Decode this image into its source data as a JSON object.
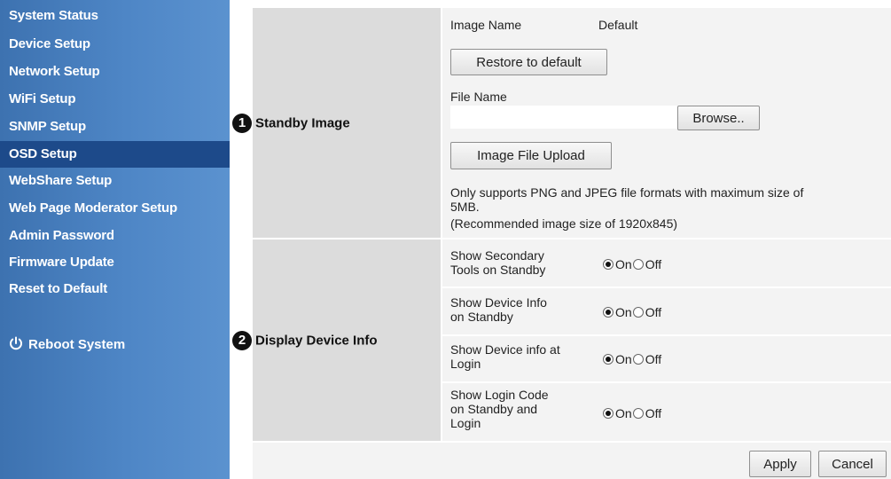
{
  "sidebar": {
    "items": [
      {
        "label": "System Status"
      },
      {
        "label": "Device Setup"
      },
      {
        "label": "Network Setup"
      },
      {
        "label": "WiFi Setup"
      },
      {
        "label": "SNMP Setup"
      },
      {
        "label": "OSD Setup",
        "active": true
      },
      {
        "label": "WebShare Setup"
      },
      {
        "label": "Web Page Moderator Setup"
      },
      {
        "label": "Admin Password"
      },
      {
        "label": "Firmware Update"
      },
      {
        "label": "Reset to Default"
      }
    ],
    "reboot_label": "Reboot System",
    "reboot_icon": "power-icon"
  },
  "standby": {
    "badge": "1",
    "label": "Standby Image",
    "image_name_label": "Image Name",
    "image_name_value": "Default",
    "restore_button": "Restore to default",
    "file_name_label": "File Name",
    "file_name_value": "",
    "browse_button": "Browse..",
    "upload_button": "Image File Upload",
    "note_line1": "Only supports PNG and JPEG file formats with maximum size of",
    "note_line2": "5MB.",
    "note_line3": "(Recommended image size of 1920x845)"
  },
  "device_info": {
    "badge": "2",
    "label": "Display Device Info",
    "options": [
      {
        "line1": "Show Secondary",
        "line2": "Tools on Standby",
        "line3": "",
        "value": "On"
      },
      {
        "line1": "Show Device Info",
        "line2": "on Standby",
        "line3": "",
        "value": "On"
      },
      {
        "line1": "Show Device info at",
        "line2": "Login",
        "line3": "",
        "value": "On"
      },
      {
        "line1": "Show Login Code",
        "line2": "on Standby and",
        "line3": "Login",
        "value": "On"
      }
    ],
    "on_label": "On",
    "off_label": "Off"
  },
  "footer": {
    "apply_button": "Apply",
    "cancel_button": "Cancel"
  },
  "colors": {
    "sidebar": "#4e86c6",
    "sidebar_active": "#1d4a8a",
    "label_column": "#dcdcdc",
    "panel": "#f3f3f3"
  }
}
